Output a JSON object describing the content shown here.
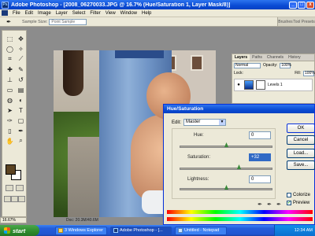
{
  "window": {
    "title": "Adobe Photoshop - [2008_06270033.JPG @ 16.7% (Hue/Saturation 1, Layer Mask/8)]",
    "btn_min": "_",
    "btn_max": "□",
    "btn_close": "x"
  },
  "menu": [
    "File",
    "Edit",
    "Image",
    "Layer",
    "Select",
    "Filter",
    "View",
    "Window",
    "Help"
  ],
  "options_bar": {
    "sample_label": "Sample Size:",
    "sample_value": "Point Sample",
    "tabs": [
      "Brushes",
      "Tool Presets"
    ]
  },
  "layers_palette": {
    "tabs": [
      "Layers",
      "Paths",
      "Channels",
      "History"
    ],
    "blend_mode": "Normal",
    "opacity_label": "Opacity:",
    "opacity_value": "100%",
    "lock_label": "Lock:",
    "fill_label": "Fill:",
    "fill_value": "100%",
    "layer_name": "Levels 1"
  },
  "status": {
    "zoom": "16.67%",
    "doc": "Doc: 20.3M/40.6M"
  },
  "dialog": {
    "title": "Hue/Saturation",
    "edit_label": "Edit:",
    "edit_value": "Master",
    "hue_label": "Hue:",
    "hue_value": "0",
    "saturation_label": "Saturation:",
    "saturation_value": "+32",
    "lightness_label": "Lightness:",
    "lightness_value": "0",
    "ok_label": "OK",
    "cancel_label": "Cancel",
    "load_label": "Load...",
    "save_label": "Save...",
    "colorize_label": "Colorize",
    "preview_label": "Preview",
    "preview_checked": true,
    "colorize_checked": false
  },
  "taskbar": {
    "start_label": "start",
    "tasks": [
      "3 Windows Explorer",
      "Adobe Photoshop - [...",
      "Untitled - Notepad"
    ],
    "clock": "12:34 AM"
  }
}
